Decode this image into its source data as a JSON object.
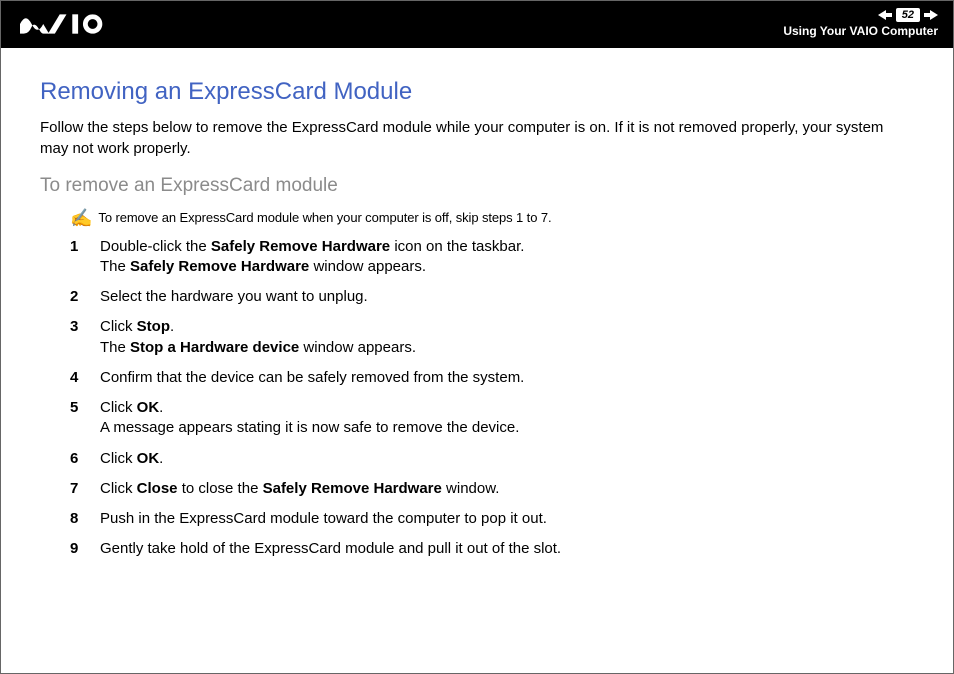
{
  "header": {
    "page_number": "52",
    "breadcrumb": "Using Your VAIO Computer"
  },
  "title": "Removing an ExpressCard Module",
  "intro": "Follow the steps below to remove the ExpressCard module while your computer is on. If it is not removed properly, your system may not work properly.",
  "subtitle": "To remove an ExpressCard module",
  "note": "To remove an ExpressCard module when your computer is off, skip steps 1 to 7.",
  "steps": {
    "s1a": "Double-click the ",
    "s1b": "Safely Remove Hardware",
    "s1c": " icon on the taskbar.",
    "s1d": "The ",
    "s1e": "Safely Remove Hardware",
    "s1f": " window appears.",
    "s2": "Select the hardware you want to unplug.",
    "s3a": "Click ",
    "s3b": "Stop",
    "s3c": ".",
    "s3d": "The ",
    "s3e": "Stop a Hardware device",
    "s3f": " window appears.",
    "s4": "Confirm that the device can be safely removed from the system.",
    "s5a": "Click ",
    "s5b": "OK",
    "s5c": ".",
    "s5d": "A message appears stating it is now safe to remove the device.",
    "s6a": "Click ",
    "s6b": "OK",
    "s6c": ".",
    "s7a": "Click ",
    "s7b": "Close",
    "s7c": " to close the ",
    "s7d": "Safely Remove Hardware",
    "s7e": " window.",
    "s8": "Push in the ExpressCard module toward the computer to pop it out.",
    "s9": "Gently take hold of the ExpressCard module and pull it out of the slot."
  }
}
